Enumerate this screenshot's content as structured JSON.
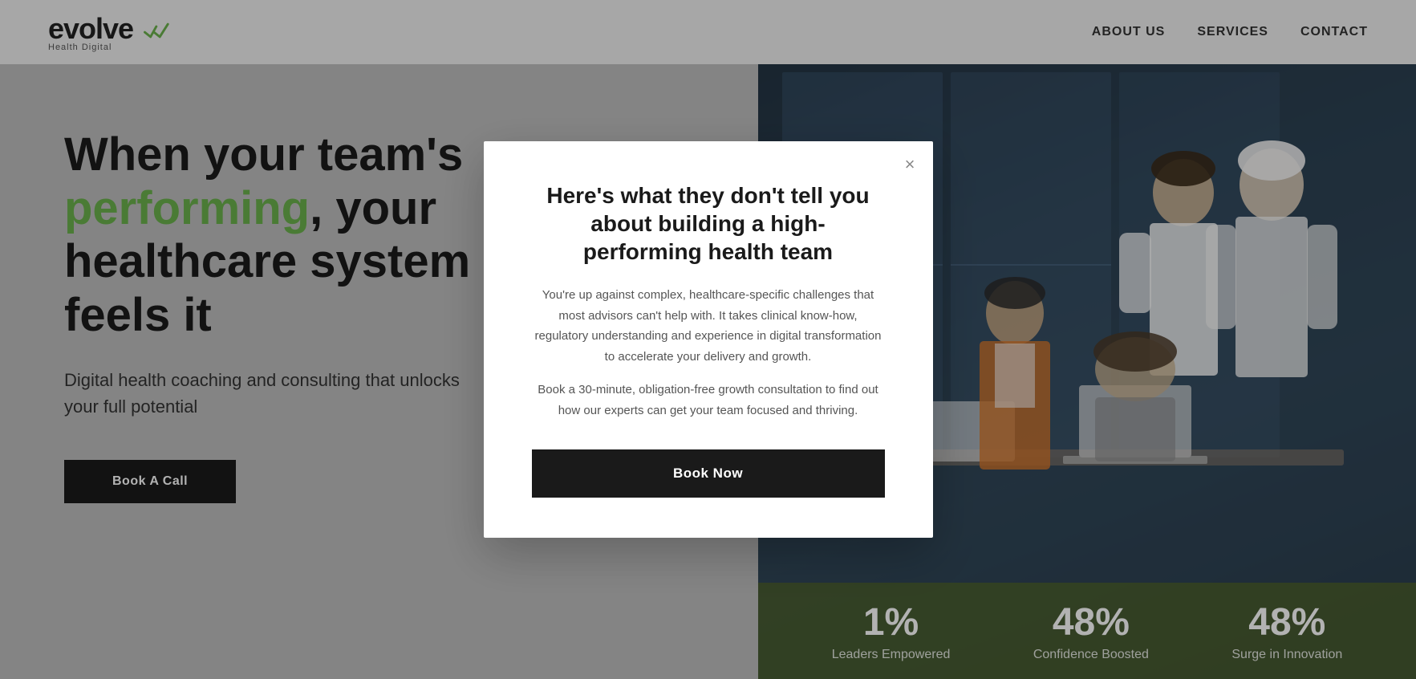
{
  "header": {
    "logo": {
      "name_part1": "evolve",
      "name_part2": "",
      "subtitle": "Health Digital"
    },
    "nav": {
      "items": [
        {
          "id": "about",
          "label": "ABOUT US"
        },
        {
          "id": "services",
          "label": "SERVICES"
        },
        {
          "id": "contact",
          "label": "CONTACT"
        }
      ]
    }
  },
  "hero": {
    "heading_line1": "When your team's",
    "heading_highlight": "performing",
    "heading_line2": ", your",
    "heading_line3": "healthcare system",
    "heading_line4": "feels it",
    "subtext": "Digital health coaching and consulting that unlocks your full potential",
    "cta_label": "Book A Call"
  },
  "stats": [
    {
      "number": "1%",
      "label": "Leaders Empowered"
    },
    {
      "number": "48%",
      "label": "Confidence Boosted"
    },
    {
      "number": "48%",
      "label": "Surge in Innovation"
    }
  ],
  "modal": {
    "title": "Here's what they don't tell you about building a high-performing health team",
    "body1": "You're up against complex, healthcare-specific challenges that most advisors can't help with. It takes clinical know-how, regulatory understanding and experience in digital transformation to accelerate your delivery and growth.",
    "body2": "Book a 30-minute, obligation-free growth consultation to find out how our experts can get your team focused and thriving.",
    "cta_label": "Book Now",
    "close_label": "×"
  }
}
